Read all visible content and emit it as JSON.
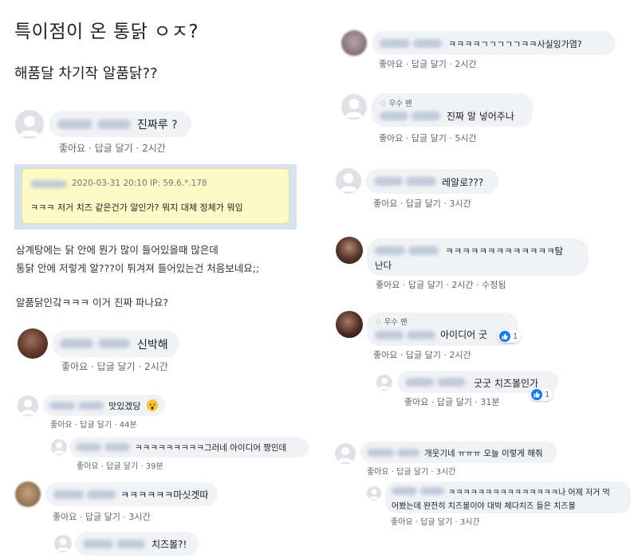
{
  "post": {
    "title": "특이점이 온 통닭 ㅇㅈ?",
    "subtitle": "해품달 차기작 알품닭??",
    "quote_meta": "2020-03-31 20:10 IP: 59.6.*.178",
    "quote_text": "ㅋㅋㅋ 저거 치즈 같은건가 알인가? 뭐지 대체 정체가 뭐임",
    "body_line1": "삼계탕에는 닭 안에 뭔가 많이 들어있을때 많은데",
    "body_line2": "통닭 안에 저렇게 알???이 튀겨져 들어있는건 처음보네요;;",
    "body_line3": "알품닭인갘ㅋㅋㅋ 이거 진짜 파나요?"
  },
  "labels": {
    "like": "좋아요",
    "reply": "답글 달기",
    "sep": "·",
    "edited": "수정됨",
    "top_fan": "우수 팬"
  },
  "left_comments": [
    {
      "text": "진짜루 ?",
      "time": "2시간"
    },
    {
      "text": "신박해",
      "time": "2시간"
    },
    {
      "text": "맛있겠당",
      "time": "44분"
    },
    {
      "text": "ㅋㅋㅋㅋㅋㅋㅋㅋㅋ그러네 아이디어 짱인데",
      "time": "39분"
    },
    {
      "text": "ㅋㅋㅋㅋㅋㅋ마싯겟따",
      "time": "3시간"
    },
    {
      "text": "치즈볼?!"
    }
  ],
  "right_comments": [
    {
      "text": "ㅋㅋㅋㅋㄱㄱㄱㄱㄱㅋㅋ사실잉가염?",
      "time": "2시간"
    },
    {
      "text": "진짜 알 넣어주나",
      "time": "5시간"
    },
    {
      "text": "레알로???",
      "time": "3시간"
    },
    {
      "text1": "ㅋㅋㅋㅋㅋㅋㅋㅋㅋㅋㅋㅋㅋ탐",
      "text2": "난다",
      "time": "2시간"
    },
    {
      "text": "아이디어 굿",
      "time": "2시간",
      "reactions": "1"
    },
    {
      "text": "굿굿 치즈볼인가",
      "time": "31분",
      "reactions": "1"
    },
    {
      "text": "개웃기네 ㅠㅠㅠ 오늘 이렇게 해줘",
      "time": "3시간"
    },
    {
      "text1": "ㅋㅋㅋㅋㅋㅋㅋㅋㅋㅋㅋㅋㅋㅋㅋ나 어제 저거 먹",
      "text2": "어봤는데 완전히 치즈볼이야 대박 체다치즈 들은 치즈볼",
      "time": "3시간"
    }
  ],
  "colors": {
    "link": "#606770",
    "bubble": "#f0f2f5",
    "like_blue": "#1877f2",
    "quote_bg": "#fdfac6"
  }
}
